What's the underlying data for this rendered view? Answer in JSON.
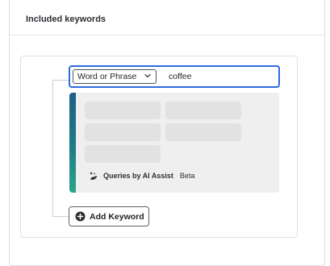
{
  "panel": {
    "title": "Included keywords"
  },
  "keyword": {
    "match_type": "Word or Phrase",
    "value": "coffee"
  },
  "suggestions": {
    "label": "Queries by AI Assist",
    "badge": "Beta",
    "loading": true
  },
  "actions": {
    "add_keyword_label": "Add Keyword"
  },
  "colors": {
    "focus_border": "#2d6cdf",
    "accent_top": "#1d5f86",
    "accent_bottom": "#2aa58b"
  },
  "icons": {
    "match_type_chevron": "chevron-down-icon",
    "ai_assist": "ai-assist-icon",
    "add_keyword": "plus-circle-icon"
  }
}
